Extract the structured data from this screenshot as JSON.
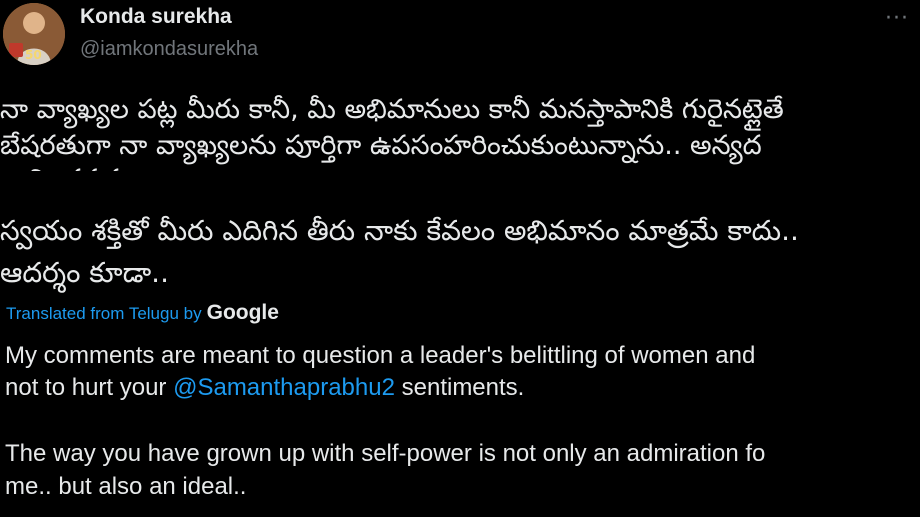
{
  "author": {
    "display_name": "Konda surekha",
    "handle": "@iamkondasurekha",
    "avatar_badge": "50"
  },
  "menu": {
    "more_label": "···"
  },
  "tweet": {
    "telugu_lines": [
      "నా వ్యాఖ్యల పట్ల మీరు కానీ, మీ అభిమానులు కానీ  మనస్తాపానికి గురైనట్లైతే",
      "బేషరతుగా నా వ్యాఖ్యలను పూర్తిగా ఉపసంహరించుకుంటున్నాను.. అన్యద",
      "భావించవద్దు",
      "స్వయం శక్తితో మీరు ఎదిగిన తీరు నాకు కేవలం  అభిమానం మాత్రమే కాదు..",
      "ఆదర్శం కూడా.."
    ],
    "translation_label": "Translated from Telugu by",
    "translation_provider": "Google",
    "english": {
      "line1": "My comments are meant to question a leader's belittling of women and",
      "line2_prefix": "not to hurt your ",
      "mention": "@Samanthaprabhu2",
      "line2_suffix": " sentiments.",
      "line3": "The way you have grown up with self-power is not only an admiration fo",
      "line4": "me.. but also an ideal.."
    }
  },
  "colors": {
    "background": "#000000",
    "text": "#e7e9ea",
    "secondary": "#71767b",
    "link": "#1d9bf0"
  }
}
